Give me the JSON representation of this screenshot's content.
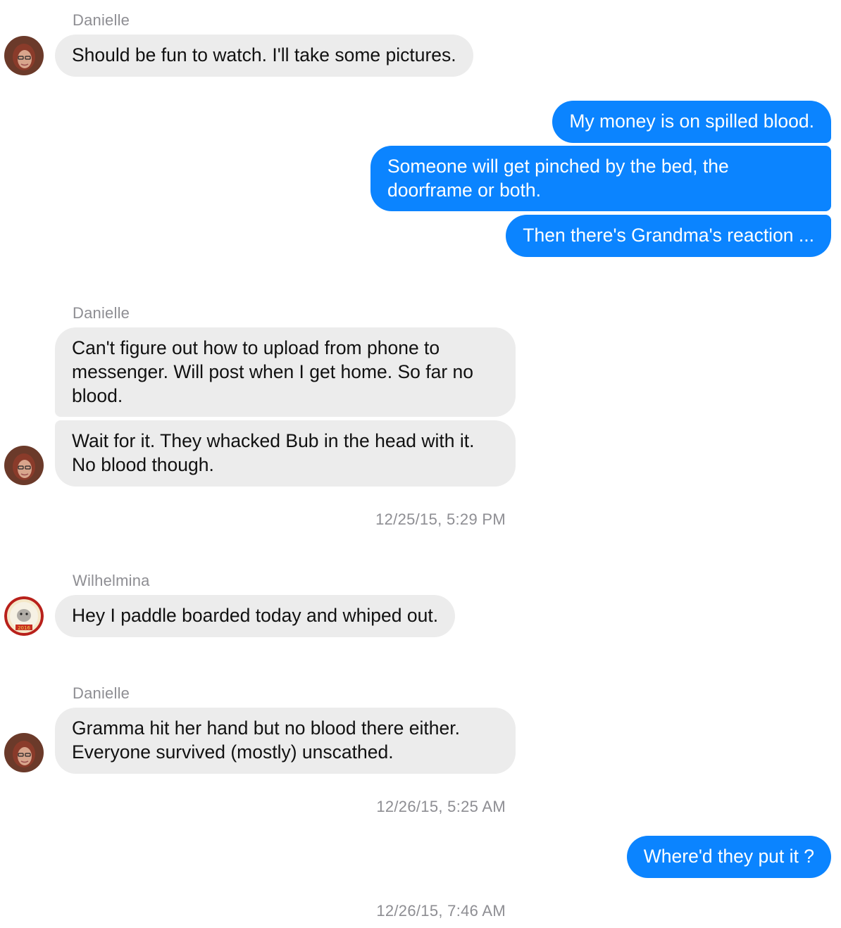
{
  "colors": {
    "incoming_bubble": "#ececec",
    "outgoing_bubble": "#0b84ff",
    "meta_text": "#8e8e93"
  },
  "conversation": {
    "group1": {
      "sender": "Danielle",
      "messages": [
        "Should be fun to watch. I'll take some pictures."
      ],
      "avatar_icon": "danielle-avatar"
    },
    "group2": {
      "messages": [
        "My money is on spilled blood.",
        "Someone will get pinched by the bed, the doorframe or both.",
        "Then there's Grandma's reaction ..."
      ]
    },
    "group3": {
      "sender": "Danielle",
      "messages": [
        "Can't figure out how to upload from phone to messenger. Will post when I get home. So far no blood.",
        "Wait for it. They whacked Bub in the head with it. No blood though."
      ],
      "avatar_icon": "danielle-avatar"
    },
    "timestamp1": "12/25/15, 5:29 PM",
    "group4": {
      "sender": "Wilhelmina",
      "messages": [
        "Hey I paddle boarded today and whiped out."
      ],
      "avatar_icon": "wilhelmina-avatar",
      "avatar_badge_text": "2016"
    },
    "group5": {
      "sender": "Danielle",
      "messages": [
        "Gramma hit her hand but no blood there either. Everyone survived (mostly) unscathed."
      ],
      "avatar_icon": "danielle-avatar"
    },
    "timestamp2": "12/26/15, 5:25 AM",
    "group6": {
      "messages": [
        "Where'd they put it ?"
      ]
    },
    "timestamp3": "12/26/15, 7:46 AM"
  }
}
